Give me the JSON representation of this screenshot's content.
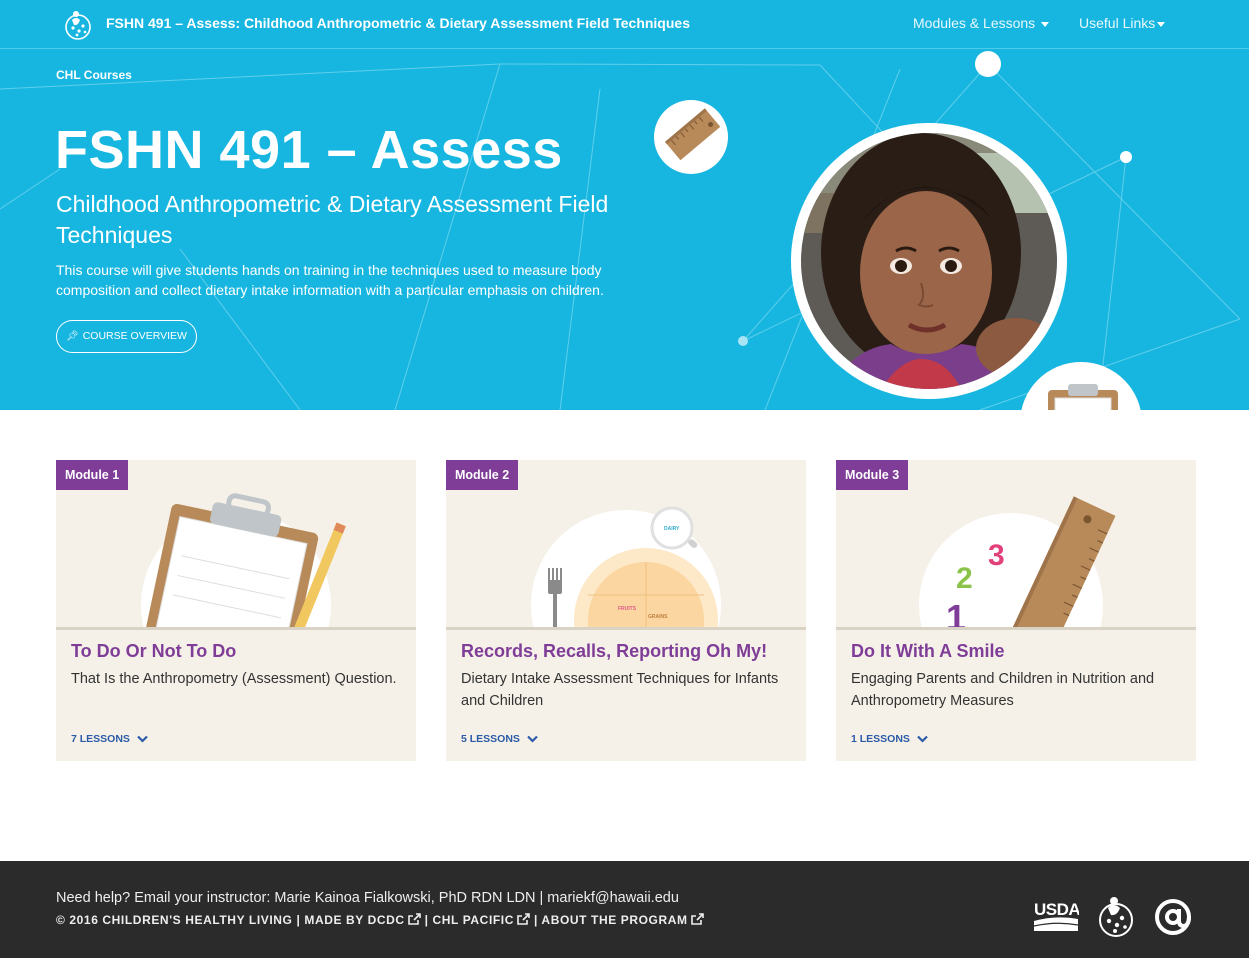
{
  "nav": {
    "title": "FSHN 491 – Assess: Childhood Anthropometric & Dietary Assessment Field Techniques",
    "modules_label": "Modules & Lessons",
    "links_label": "Useful Links"
  },
  "hero": {
    "breadcrumb": "CHL Courses",
    "title": "FSHN 491 – Assess",
    "subtitle": "Childhood Anthropometric & Dietary Assessment Field Techniques",
    "description": "This course will give students hands on training in the techniques used to measure body composition and collect dietary intake information with a particular emphasis on children.",
    "overview_button": "COURSE OVERVIEW"
  },
  "modules": [
    {
      "badge": "Module 1",
      "title": "To Do Or Not To Do",
      "description": "That Is the Anthropometry (Assessment) Question.",
      "lessons": "7 LESSONS"
    },
    {
      "badge": "Module 2",
      "title": "Records, Recalls, Reporting Oh My!",
      "description": "Dietary Intake Assessment Techniques for Infants and Children",
      "lessons": "5 LESSONS",
      "art_labels": {
        "dairy": "DAIRY",
        "fruits": "FRUITS",
        "grains": "GRAINS"
      }
    },
    {
      "badge": "Module 3",
      "title": "Do It With A Smile",
      "description": "Engaging Parents and Children in Nutrition and Anthropometry Measures",
      "lessons": "1 LESSONS",
      "art_labels": {
        "n1": "1",
        "n2": "2",
        "n3": "3"
      }
    }
  ],
  "footer": {
    "help": "Need help? Email your instructor: Marie Kainoa Fialkowski, PhD RDN LDN | mariekf@hawaii.edu",
    "copyright": "© 2016 CHILDREN'S HEALTHY LIVING",
    "sep": "|",
    "made_by": "MADE BY DCDC",
    "chl_pacific": "CHL PACIFIC",
    "about": "ABOUT THE PROGRAM",
    "logos": {
      "usda": "USDA"
    }
  },
  "colors": {
    "brand_blue": "#17b6e0",
    "module_purple": "#7f3d98",
    "link_blue": "#2a5aa8",
    "footer_dark": "#2b2b2b",
    "card_bg": "#f5f1e8"
  },
  "icons": [
    "chl-logo-icon",
    "caret-down-icon",
    "pin-icon",
    "chevron-down-icon",
    "external-link-icon",
    "usda-logo",
    "chl-seal-logo",
    "at-sign-logo"
  ]
}
